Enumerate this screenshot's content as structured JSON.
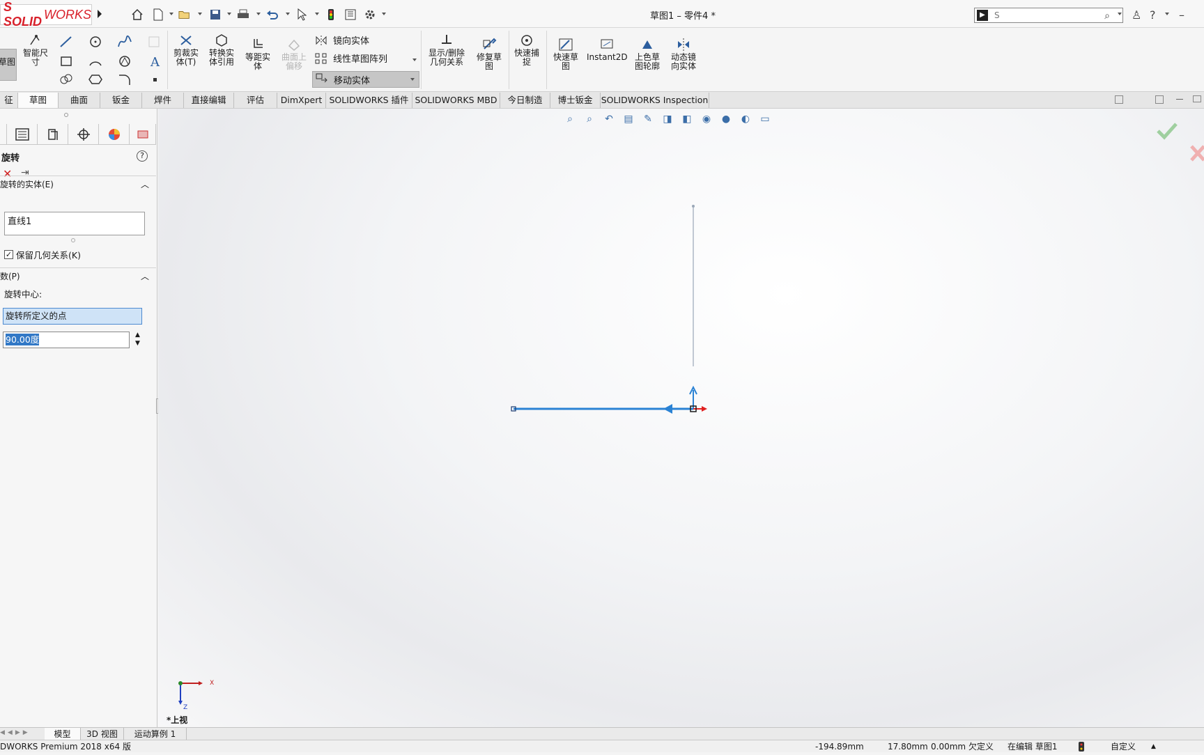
{
  "app": {
    "brand_bold": "S SOLID",
    "brand_rest": "WORKS",
    "doc_title": "草图1 – 零件4 *"
  },
  "search": {
    "value": "S"
  },
  "ribbon": {
    "sketch_btn": "草图",
    "smart_dim": "智能尺寸",
    "trim": "剪裁实体(T)",
    "convert": "转换实体引用",
    "offset": "等距实体",
    "surface_offset": "曲面上偏移",
    "mirror": "镜向实体",
    "linear_pattern": "线性草图阵列",
    "move_entity": "移动实体",
    "show_relations": "显示/删除几何关系",
    "repair": "修复草图",
    "quick_snap": "快速捕捉",
    "rapid_sketch": "快速草图",
    "instant2d": "Instant2D",
    "shaded_contours": "上色草图轮廓",
    "dynamic_mirror": "动态镜向实体"
  },
  "tabs": [
    {
      "label": "征"
    },
    {
      "label": "草图"
    },
    {
      "label": "曲面"
    },
    {
      "label": "钣金"
    },
    {
      "label": "焊件"
    },
    {
      "label": "直接编辑"
    },
    {
      "label": "评估"
    },
    {
      "label": "DimXpert"
    },
    {
      "label": "SOLIDWORKS 插件"
    },
    {
      "label": "SOLIDWORKS MBD"
    },
    {
      "label": "今日制造"
    },
    {
      "label": "博士钣金"
    },
    {
      "label": "SOLIDWORKS Inspection"
    }
  ],
  "property_manager": {
    "title": "旋转",
    "section_entities": "旋转的实体(E)",
    "entities_list": [
      "直线1"
    ],
    "keep_relations_label": "保留几何关系(K)",
    "keep_relations_checked": true,
    "section_params": "数(P)",
    "center_label": "旋转中心:",
    "center_value": "旋转所定义的点",
    "angle_value": "90.00度"
  },
  "viewport": {
    "view_label": "*上视",
    "axis_x": "X",
    "axis_z": "Z"
  },
  "bottom_tabs": [
    {
      "label": "模型"
    },
    {
      "label": "3D 视图"
    },
    {
      "label": "运动算例 1"
    }
  ],
  "status": {
    "product": "DWORKS Premium 2018 x64 版",
    "x": "-194.89mm",
    "y": "17.80mm",
    "z": "0.00mm",
    "state": "欠定义",
    "editing": "在编辑 草图1",
    "units": "自定义"
  },
  "colors": {
    "brand_red": "#d8202a",
    "sketch_blue": "#2a82d4",
    "accent_selected": "#cfe3f7"
  }
}
